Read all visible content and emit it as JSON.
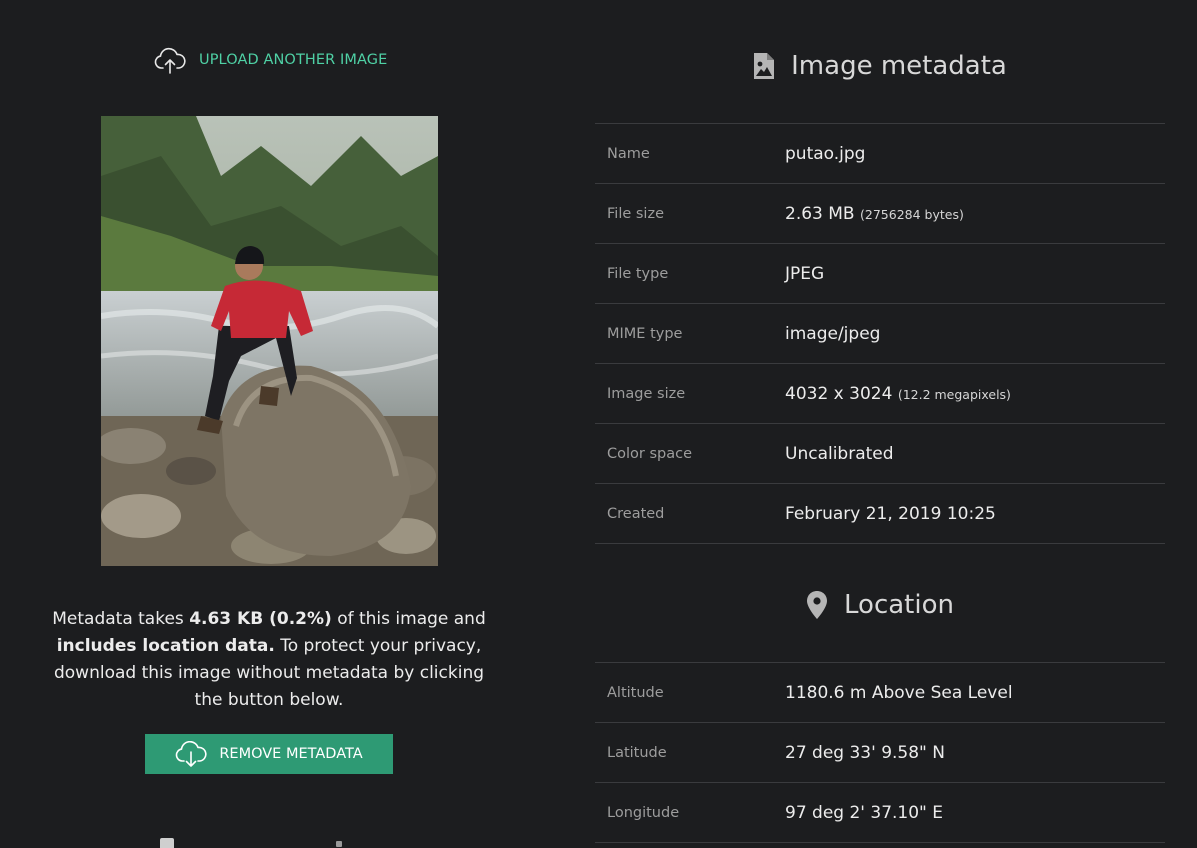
{
  "upload": {
    "label": "UPLOAD ANOTHER IMAGE",
    "icon": "cloud-upload-icon"
  },
  "notice": {
    "p1": "Metadata takes ",
    "size": "4.63 KB (0.2%)",
    "p2": " of this image and ",
    "loc": "includes location data.",
    "p3": " To protect your privacy, download this image without metadata by clicking the button below."
  },
  "remove": {
    "label": "REMOVE METADATA",
    "icon": "cloud-download-icon"
  },
  "meta": {
    "title": "Image metadata",
    "icon": "image-file-icon",
    "rows": [
      {
        "key": "Name",
        "value": "putao.jpg",
        "extra": ""
      },
      {
        "key": "File size",
        "value": "2.63 MB",
        "extra": "(2756284 bytes)"
      },
      {
        "key": "File type",
        "value": "JPEG",
        "extra": ""
      },
      {
        "key": "MIME type",
        "value": "image/jpeg",
        "extra": ""
      },
      {
        "key": "Image size",
        "value": "4032 x 3024",
        "extra": "(12.2 megapixels)"
      },
      {
        "key": "Color space",
        "value": "Uncalibrated",
        "extra": ""
      },
      {
        "key": "Created",
        "value": "February 21, 2019 10:25",
        "extra": ""
      }
    ]
  },
  "location": {
    "title": "Location",
    "icon": "map-pin-icon",
    "rows": [
      {
        "key": "Altitude",
        "value": "1180.6 m Above Sea Level"
      },
      {
        "key": "Latitude",
        "value": "27 deg 33' 9.58\" N"
      },
      {
        "key": "Longitude",
        "value": "97 deg 2' 37.10\" E"
      }
    ]
  },
  "colors": {
    "accent": "#4fd1a5",
    "button": "#2e9a74",
    "background": "#1c1d1f"
  }
}
